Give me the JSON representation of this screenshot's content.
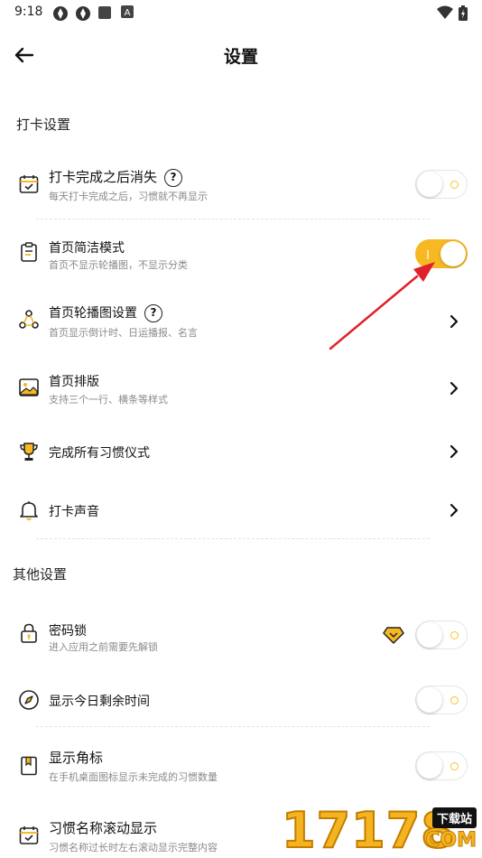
{
  "status": {
    "time": "9:18"
  },
  "header": {
    "title": "设置"
  },
  "sections": [
    {
      "title": "打卡设置"
    },
    {
      "title": "其他设置"
    }
  ],
  "rows": [
    {
      "label": "打卡完成之后消失",
      "sub": "每天打卡完成之后，习惯就不再显示",
      "help": "?",
      "icon": "calendar-check-icon",
      "control": "toggle",
      "on": false
    },
    {
      "label": "首页简洁模式",
      "sub": "首页不显示轮播图，不显示分类",
      "icon": "clipboard-icon",
      "control": "toggle",
      "on": true
    },
    {
      "label": "首页轮播图设置",
      "sub": "首页显示倒计时、日运播报、名言",
      "help": "?",
      "icon": "carousel-nodes-icon",
      "control": "chevron"
    },
    {
      "label": "首页排版",
      "sub": "支持三个一行、横条等样式",
      "icon": "image-icon",
      "control": "chevron"
    },
    {
      "label": "完成所有习惯仪式",
      "icon": "trophy-icon",
      "control": "chevron"
    },
    {
      "label": "打卡声音",
      "icon": "bell-icon",
      "control": "chevron"
    },
    {
      "label": "密码锁",
      "sub": "进入应用之前需要先解锁",
      "icon": "lock-icon",
      "badge": "vip-diamond-icon",
      "control": "toggle",
      "on": false
    },
    {
      "label": "显示今日剩余时间",
      "icon": "compass-icon",
      "control": "toggle",
      "on": false
    },
    {
      "label": "显示角标",
      "sub": "在手机桌面图标显示未完成的习惯数量",
      "icon": "bookmark-icon",
      "control": "toggle",
      "on": false
    },
    {
      "label": "习惯名称滚动显示",
      "sub": "习惯名称过长时左右滚动显示完整内容",
      "icon": "calendar-check-icon",
      "control": "toggle",
      "on": false
    }
  ],
  "watermark": {
    "digits": "17178",
    "box": "下载站",
    "com": "COM"
  },
  "colors": {
    "accent": "#f6b923",
    "arrow": "#e0202a",
    "sub_text": "#8a8a8a"
  }
}
